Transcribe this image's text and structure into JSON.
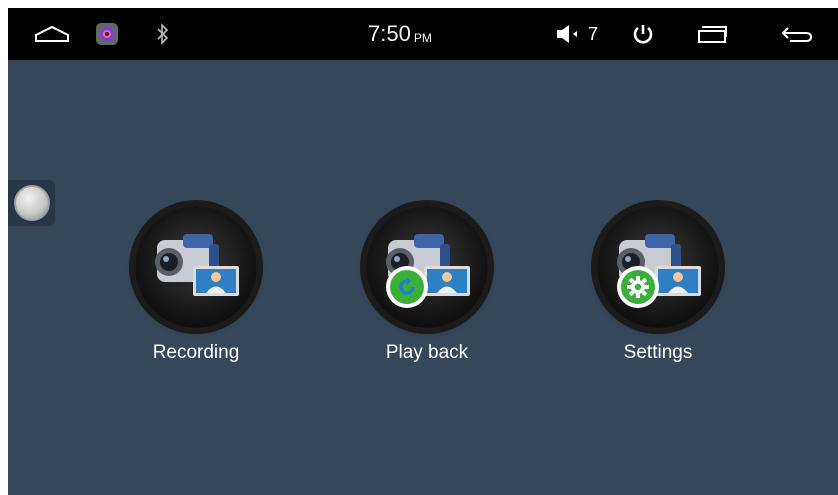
{
  "status_bar": {
    "time": "7:50",
    "ampm": "PM",
    "volume": "7"
  },
  "apps": [
    {
      "label": "Recording"
    },
    {
      "label": "Play back"
    },
    {
      "label": "Settings"
    }
  ],
  "colors": {
    "background": "#36475a",
    "status_bar": "#000000",
    "badge_green": "#3cae3c"
  }
}
